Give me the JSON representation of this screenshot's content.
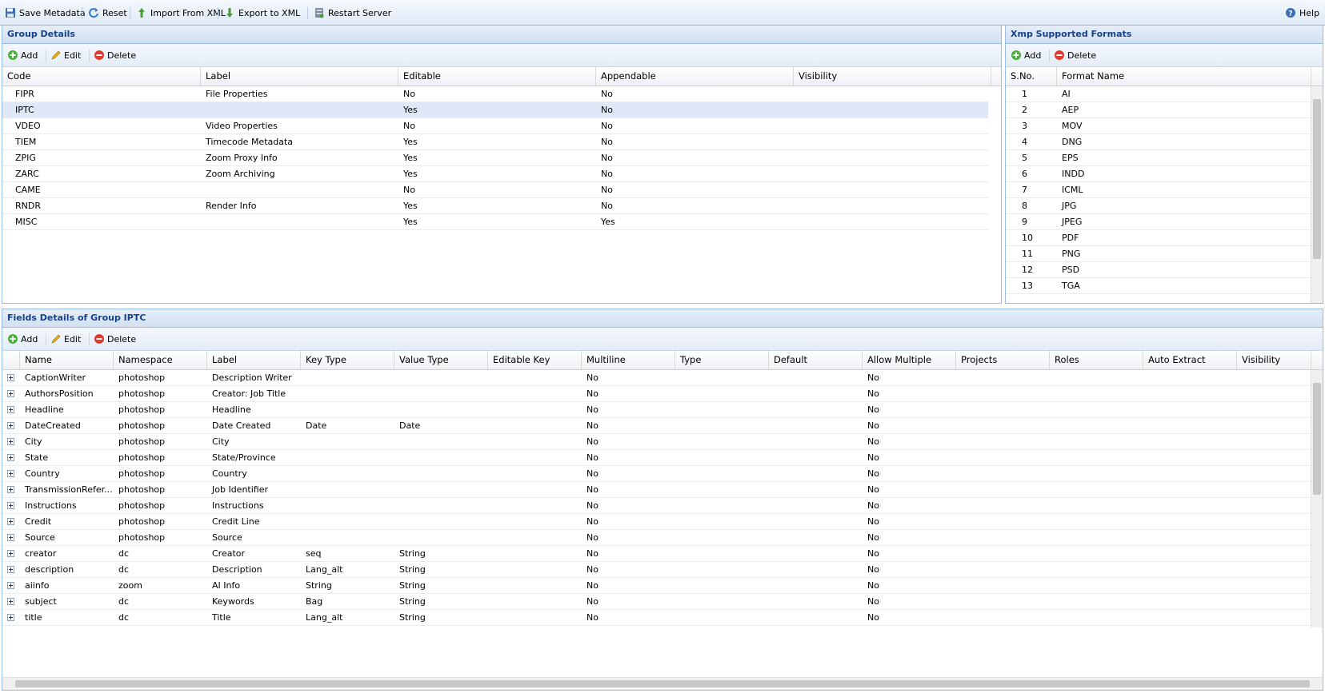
{
  "toolbar": {
    "save": "Save Metadata",
    "reset": "Reset",
    "import": "Import From XML",
    "export": "Export to XML",
    "restart": "Restart Server",
    "help": "Help"
  },
  "group_panel": {
    "title": "Group Details",
    "add": "Add",
    "edit": "Edit",
    "delete": "Delete",
    "columns": [
      "Code",
      "Label",
      "Editable",
      "Appendable",
      "Visibility"
    ],
    "rows": [
      {
        "code": "FIPR",
        "label": "File Properties",
        "editable": "No",
        "appendable": "No",
        "visibility": ""
      },
      {
        "code": "IPTC",
        "label": "",
        "editable": "Yes",
        "appendable": "No",
        "visibility": "",
        "selected": true
      },
      {
        "code": "VDEO",
        "label": "Video Properties",
        "editable": "No",
        "appendable": "No",
        "visibility": ""
      },
      {
        "code": "TIEM",
        "label": "Timecode Metadata",
        "editable": "Yes",
        "appendable": "No",
        "visibility": ""
      },
      {
        "code": "ZPIG",
        "label": "Zoom Proxy Info",
        "editable": "Yes",
        "appendable": "No",
        "visibility": ""
      },
      {
        "code": "ZARC",
        "label": "Zoom Archiving",
        "editable": "Yes",
        "appendable": "No",
        "visibility": ""
      },
      {
        "code": "CAME",
        "label": "",
        "editable": "No",
        "appendable": "No",
        "visibility": ""
      },
      {
        "code": "RNDR",
        "label": "Render Info",
        "editable": "Yes",
        "appendable": "No",
        "visibility": ""
      },
      {
        "code": "MISC",
        "label": "",
        "editable": "Yes",
        "appendable": "Yes",
        "visibility": ""
      }
    ]
  },
  "formats_panel": {
    "title": "Xmp Supported Formats",
    "add": "Add",
    "delete": "Delete",
    "columns": [
      "S.No.",
      "Format Name"
    ],
    "rows": [
      {
        "sno": "1",
        "name": "AI"
      },
      {
        "sno": "2",
        "name": "AEP"
      },
      {
        "sno": "3",
        "name": "MOV"
      },
      {
        "sno": "4",
        "name": "DNG"
      },
      {
        "sno": "5",
        "name": "EPS"
      },
      {
        "sno": "6",
        "name": "INDD"
      },
      {
        "sno": "7",
        "name": "ICML"
      },
      {
        "sno": "8",
        "name": "JPG"
      },
      {
        "sno": "9",
        "name": "JPEG"
      },
      {
        "sno": "10",
        "name": "PDF"
      },
      {
        "sno": "11",
        "name": "PNG"
      },
      {
        "sno": "12",
        "name": "PSD"
      },
      {
        "sno": "13",
        "name": "TGA"
      }
    ]
  },
  "fields_panel": {
    "title": "Fields Details of Group IPTC",
    "add": "Add",
    "edit": "Edit",
    "delete": "Delete",
    "columns": [
      "Name",
      "Namespace",
      "Label",
      "Key Type",
      "Value Type",
      "Editable Key",
      "Multiline",
      "Type",
      "Default",
      "Allow Multiple",
      "Projects",
      "Roles",
      "Auto Extract",
      "Visibility"
    ],
    "rows": [
      {
        "name": "CaptionWriter",
        "ns": "photoshop",
        "label": "Description Writer",
        "keytype": "",
        "valuetype": "",
        "multiline": "No",
        "allowmultiple": "No"
      },
      {
        "name": "AuthorsPosition",
        "ns": "photoshop",
        "label": "Creator: Job Title",
        "keytype": "",
        "valuetype": "",
        "multiline": "No",
        "allowmultiple": "No"
      },
      {
        "name": "Headline",
        "ns": "photoshop",
        "label": "Headline",
        "keytype": "",
        "valuetype": "",
        "multiline": "No",
        "allowmultiple": "No"
      },
      {
        "name": "DateCreated",
        "ns": "photoshop",
        "label": "Date Created",
        "keytype": "Date",
        "valuetype": "Date",
        "multiline": "No",
        "allowmultiple": "No"
      },
      {
        "name": "City",
        "ns": "photoshop",
        "label": "City",
        "keytype": "",
        "valuetype": "",
        "multiline": "No",
        "allowmultiple": "No"
      },
      {
        "name": "State",
        "ns": "photoshop",
        "label": "State/Province",
        "keytype": "",
        "valuetype": "",
        "multiline": "No",
        "allowmultiple": "No"
      },
      {
        "name": "Country",
        "ns": "photoshop",
        "label": "Country",
        "keytype": "",
        "valuetype": "",
        "multiline": "No",
        "allowmultiple": "No"
      },
      {
        "name": "TransmissionRefer...",
        "ns": "photoshop",
        "label": "Job Identifier",
        "keytype": "",
        "valuetype": "",
        "multiline": "No",
        "allowmultiple": "No"
      },
      {
        "name": "Instructions",
        "ns": "photoshop",
        "label": "Instructions",
        "keytype": "",
        "valuetype": "",
        "multiline": "No",
        "allowmultiple": "No"
      },
      {
        "name": "Credit",
        "ns": "photoshop",
        "label": "Credit Line",
        "keytype": "",
        "valuetype": "",
        "multiline": "No",
        "allowmultiple": "No"
      },
      {
        "name": "Source",
        "ns": "photoshop",
        "label": "Source",
        "keytype": "",
        "valuetype": "",
        "multiline": "No",
        "allowmultiple": "No"
      },
      {
        "name": "creator",
        "ns": "dc",
        "label": "Creator",
        "keytype": "seq",
        "valuetype": "String",
        "multiline": "No",
        "allowmultiple": "No"
      },
      {
        "name": "description",
        "ns": "dc",
        "label": "Description",
        "keytype": "Lang_alt",
        "valuetype": "String",
        "multiline": "No",
        "allowmultiple": "No"
      },
      {
        "name": "aiinfo",
        "ns": "zoom",
        "label": "AI Info",
        "keytype": "String",
        "valuetype": "String",
        "multiline": "No",
        "allowmultiple": "No"
      },
      {
        "name": "subject",
        "ns": "dc",
        "label": "Keywords",
        "keytype": "Bag",
        "valuetype": "String",
        "multiline": "No",
        "allowmultiple": "No"
      },
      {
        "name": "title",
        "ns": "dc",
        "label": "Title",
        "keytype": "Lang_alt",
        "valuetype": "String",
        "multiline": "No",
        "allowmultiple": "No"
      }
    ]
  }
}
